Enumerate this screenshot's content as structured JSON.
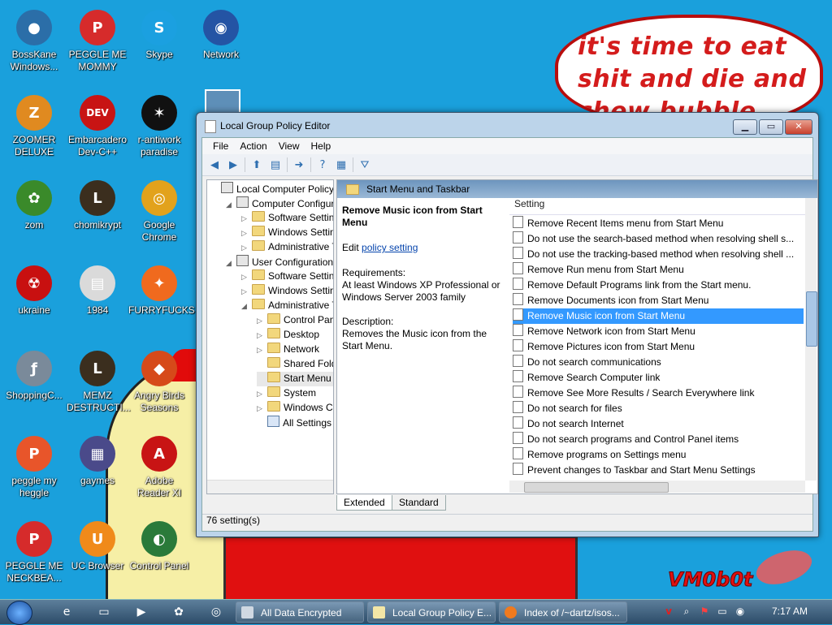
{
  "wallpaper": {
    "bubble_text": "it's time to eat shit and die and chew bubble gum",
    "signature": "VM0b0t"
  },
  "desktop_icons": [
    {
      "label": "BossKane Windows...",
      "glyph": "●",
      "color": "#2b6ea8"
    },
    {
      "label": "PEGGLE ME MOMMY",
      "glyph": "P",
      "color": "#d62b2b"
    },
    {
      "label": "Skype",
      "glyph": "S",
      "color": "#1ba0e0"
    },
    {
      "label": "Network",
      "glyph": "◉",
      "color": "#2454a4"
    },
    {
      "label": "ZOOMER DELUXE",
      "glyph": "Z",
      "color": "#e08a20"
    },
    {
      "label": "Embarcadero Dev-C++",
      "glyph": "DEV",
      "color": "#c81414"
    },
    {
      "label": "r-antiwork paradise",
      "glyph": "✶",
      "color": "#111111"
    },
    {
      "label": "zom",
      "glyph": "✿",
      "color": "#3a8a2a"
    },
    {
      "label": "chomikrypt",
      "glyph": "L",
      "color": "#3b2e1e"
    },
    {
      "label": "Google Chrome",
      "glyph": "◎",
      "color": "#e2a21c"
    },
    {
      "label": "ukraine",
      "glyph": "☢",
      "color": "#c81010"
    },
    {
      "label": "1984",
      "glyph": "▤",
      "color": "#dadada"
    },
    {
      "label": "FURRYFUCKS",
      "glyph": "✦",
      "color": "#f06a1e"
    },
    {
      "label": "ShoppingC...",
      "glyph": "ƒ",
      "color": "#7a8a9a"
    },
    {
      "label": "MEMZ DESTRUCTI...",
      "glyph": "L",
      "color": "#3b2e1e"
    },
    {
      "label": "Angry Birds Seasons",
      "glyph": "◆",
      "color": "#d64a1a"
    },
    {
      "label": "peggle my heggle",
      "glyph": "P",
      "color": "#e8552a"
    },
    {
      "label": "gaymes",
      "glyph": "▦",
      "color": "#4a4a8a"
    },
    {
      "label": "Adobe Reader XI",
      "glyph": "A",
      "color": "#c81414"
    },
    {
      "label": "PEGGLE ME NECKBEA...",
      "glyph": "P",
      "color": "#d62b2b"
    },
    {
      "label": "UC Browser",
      "glyph": "U",
      "color": "#f08a1a"
    },
    {
      "label": "Control Panel",
      "glyph": "◐",
      "color": "#2a7a3a"
    }
  ],
  "window": {
    "title": "Local Group Policy Editor",
    "menu": [
      "File",
      "Action",
      "View",
      "Help"
    ],
    "tree": [
      {
        "label": "Local Computer Policy",
        "twisty": "",
        "icon": "pc"
      },
      {
        "label": "Computer Configura",
        "twisty": "◢",
        "icon": "pc"
      },
      {
        "label": "Software Settings",
        "twisty": "▷",
        "icon": "folder"
      },
      {
        "label": "Windows Setting",
        "twisty": "▷",
        "icon": "folder"
      },
      {
        "label": "Administrative Te",
        "twisty": "▷",
        "icon": "folder"
      },
      {
        "label": "User Configuration",
        "twisty": "◢",
        "icon": "pc"
      },
      {
        "label": "Software Settings",
        "twisty": "▷",
        "icon": "folder"
      },
      {
        "label": "Windows Setting",
        "twisty": "▷",
        "icon": "folder"
      },
      {
        "label": "Administrative Te",
        "twisty": "◢",
        "icon": "folder"
      },
      {
        "label": "Control Panel",
        "twisty": "▷",
        "icon": "folder"
      },
      {
        "label": "Desktop",
        "twisty": "▷",
        "icon": "folder"
      },
      {
        "label": "Network",
        "twisty": "▷",
        "icon": "folder"
      },
      {
        "label": "Shared Folder",
        "twisty": "",
        "icon": "folder"
      },
      {
        "label": "Start Menu ar",
        "twisty": "",
        "icon": "folder"
      },
      {
        "label": "System",
        "twisty": "▷",
        "icon": "folder"
      },
      {
        "label": "Windows Cor",
        "twisty": "▷",
        "icon": "folder"
      },
      {
        "label": "All Settings",
        "twisty": "",
        "icon": "policy"
      }
    ],
    "right_header": "Start Menu and Taskbar",
    "desc": {
      "title": "Remove Music icon from Start Menu",
      "edit_prefix": "Edit",
      "edit_link": "policy setting",
      "req_label": "Requirements:",
      "req_text": "At least Windows XP Professional or Windows Server 2003 family",
      "desc_label": "Description:",
      "desc_text": "Removes the Music icon from the Start Menu."
    },
    "list_header": "Setting",
    "settings": [
      "Remove Recent Items menu from Start Menu",
      "Do not use the search-based method when resolving shell s...",
      "Do not use the tracking-based method when resolving shell ...",
      "Remove Run menu from Start Menu",
      "Remove Default Programs link from the Start menu.",
      "Remove Documents icon from Start Menu",
      "Remove Music icon from Start Menu",
      "Remove Network icon from Start Menu",
      "Remove Pictures icon from Start Menu",
      "Do not search communications",
      "Remove Search Computer link",
      "Remove See More Results / Search Everywhere link",
      "Do not search for files",
      "Do not search Internet",
      "Do not search programs and Control Panel items",
      "Remove programs on Settings menu",
      "Prevent changes to Taskbar and Start Menu Settings"
    ],
    "selected_setting": "Remove Music icon from Start Menu",
    "tabs": [
      "Extended",
      "Standard"
    ],
    "status": "76 setting(s)"
  },
  "taskbar": {
    "buttons": [
      {
        "label": "All Data Encrypted",
        "color": "#cfd8e2"
      },
      {
        "label": "Local Group Policy E...",
        "color": "#f3e6a6"
      },
      {
        "label": "Index of /~dartz/isos...",
        "color": "#f07a1e"
      }
    ],
    "time": "7:17 AM"
  }
}
